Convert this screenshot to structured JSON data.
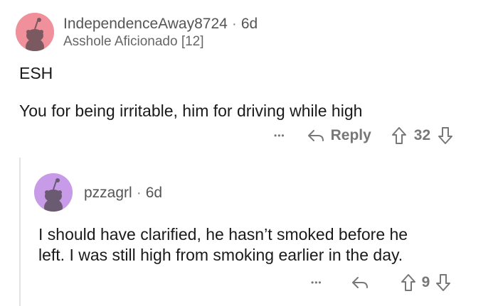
{
  "comment": {
    "username": "IndependenceAway8724",
    "time": "6d",
    "flair": "Asshole Aficionado [12]",
    "verdict": "ESH",
    "text": "You for being irritable, him for driving while high",
    "more": "•••",
    "reply_label": "Reply",
    "score": "32",
    "avatar_color": "#f0909b"
  },
  "reply": {
    "username": "pzzagrl",
    "time": "6d",
    "line1": "I should have clarified, he hasn’t smoked before he",
    "line2": "left. I was still high from smoking earlier in the day.",
    "more": "•••",
    "score": "9",
    "avatar_color": "#c79be8"
  },
  "colors": {
    "text": "#1a1a1a",
    "muted": "#777777",
    "thread": "#e3e3e3"
  }
}
